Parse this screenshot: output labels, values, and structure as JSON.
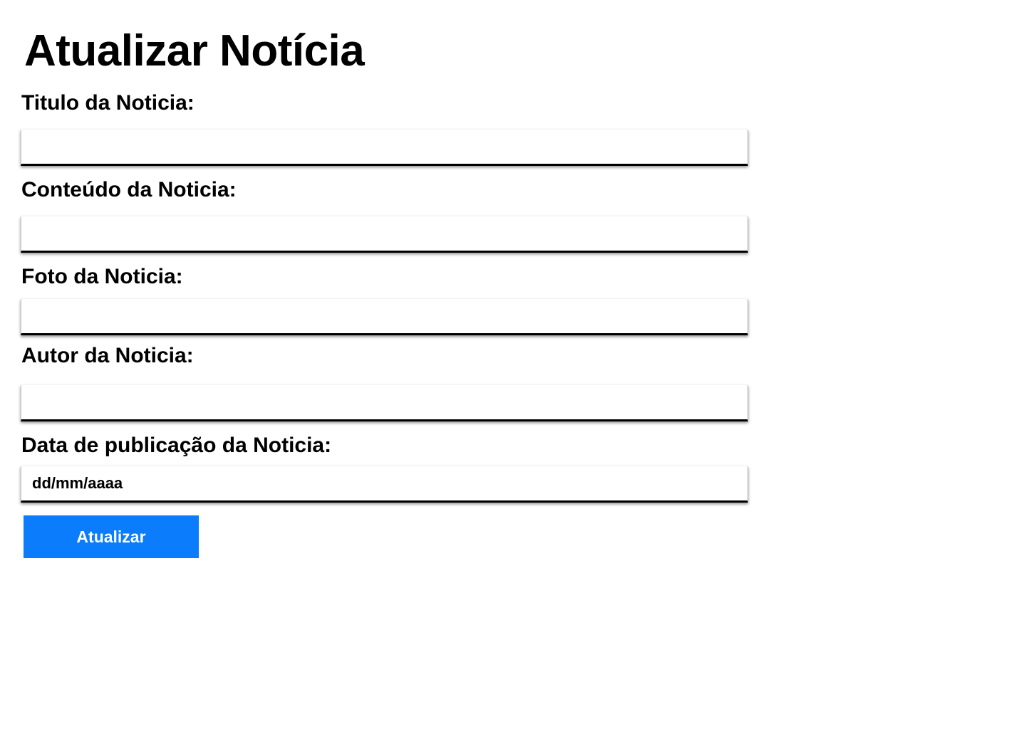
{
  "page": {
    "title": "Atualizar Notícia"
  },
  "form": {
    "title_label": "Titulo da Noticia:",
    "title_value": "",
    "content_label": "Conteúdo da Noticia:",
    "content_value": "",
    "photo_label": "Foto da Noticia:",
    "photo_value": "",
    "author_label": "Autor da Noticia:",
    "author_value": "",
    "date_label": "Data de publicação da Noticia:",
    "date_placeholder": "dd/mm/aaaa",
    "submit_label": "Atualizar"
  },
  "colors": {
    "button_background": "#0a7cfc",
    "button_text": "#ffffff",
    "text": "#000000",
    "background": "#ffffff"
  }
}
